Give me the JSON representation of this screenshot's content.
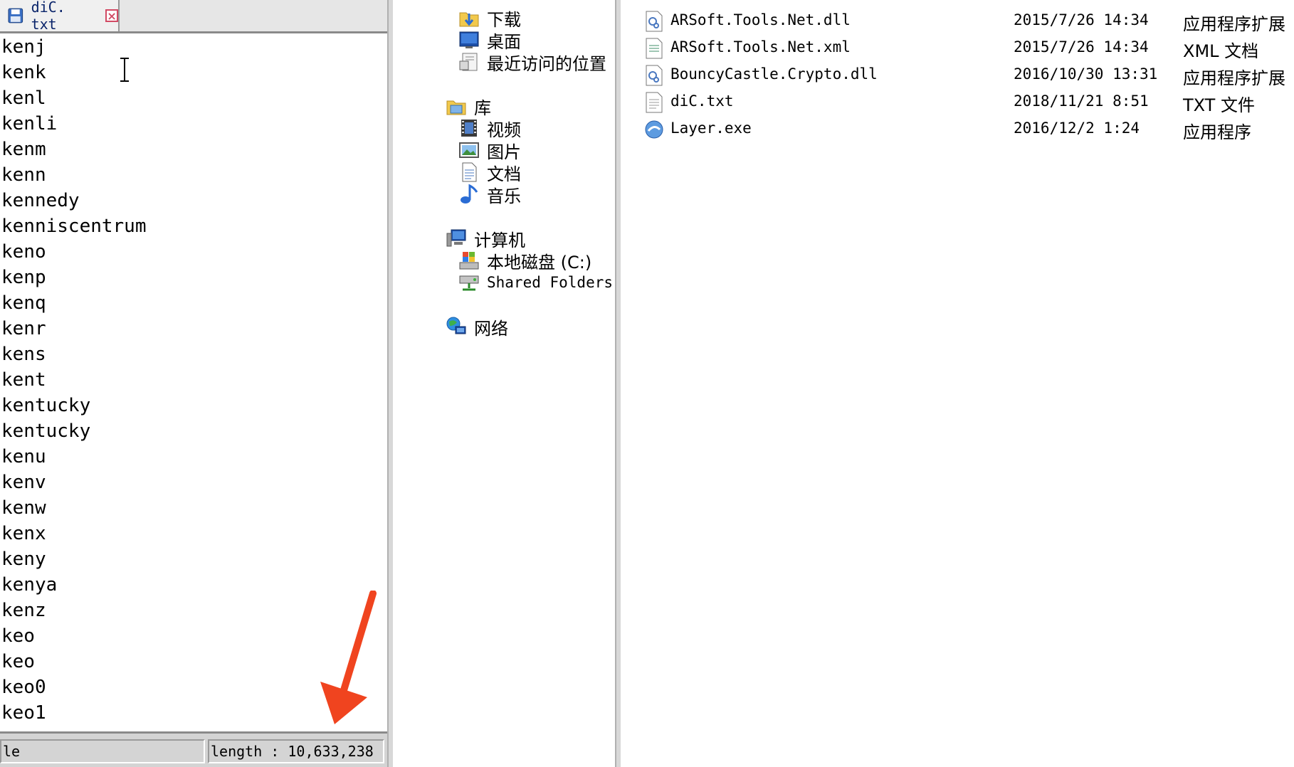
{
  "editor": {
    "tab_label": "diC. txt",
    "lines": [
      "kenj",
      "kenk",
      "kenl",
      "kenli",
      "kenm",
      "kenn",
      "kennedy",
      "kenniscentrum",
      "keno",
      "kenp",
      "kenq",
      "kenr",
      "kens",
      "kent",
      "kentucky",
      "kentucky",
      "kenu",
      "kenv",
      "kenw",
      "kenx",
      "keny",
      "kenya",
      "kenz",
      "keo",
      "keo",
      "keo0",
      "keo1"
    ],
    "status_left": "le",
    "status_right": "length : 10,633,238"
  },
  "nav": {
    "items": [
      {
        "label": "下载",
        "icon": "download-folder-icon"
      },
      {
        "label": "桌面",
        "icon": "desktop-icon"
      },
      {
        "label": "最近访问的位置",
        "icon": "recent-places-icon"
      },
      {
        "label": "库",
        "icon": "library-icon"
      },
      {
        "label": "视频",
        "icon": "video-icon"
      },
      {
        "label": "图片",
        "icon": "pictures-icon"
      },
      {
        "label": "文档",
        "icon": "documents-icon"
      },
      {
        "label": "音乐",
        "icon": "music-icon"
      },
      {
        "label": "计算机",
        "icon": "computer-icon"
      },
      {
        "label": "本地磁盘 (C:)",
        "icon": "local-disk-icon"
      },
      {
        "label": "Shared Folders (\\\\",
        "icon": "network-drive-icon"
      },
      {
        "label": "网络",
        "icon": "network-icon"
      }
    ]
  },
  "files": [
    {
      "name": "ARSoft.Tools.Net.dll",
      "date": "2015/7/26 14:34",
      "type": "应用程序扩展",
      "icon": "dll-file-icon"
    },
    {
      "name": "ARSoft.Tools.Net.xml",
      "date": "2015/7/26 14:34",
      "type": "XML 文档",
      "icon": "xml-file-icon"
    },
    {
      "name": "BouncyCastle.Crypto.dll",
      "date": "2016/10/30 13:31",
      "type": "应用程序扩展",
      "icon": "dll-file-icon"
    },
    {
      "name": "diC.txt",
      "date": "2018/11/21 8:51",
      "type": "TXT 文件",
      "icon": "txt-file-icon"
    },
    {
      "name": "Layer.exe",
      "date": "2016/12/2 1:24",
      "type": "应用程序",
      "icon": "exe-file-icon"
    }
  ]
}
